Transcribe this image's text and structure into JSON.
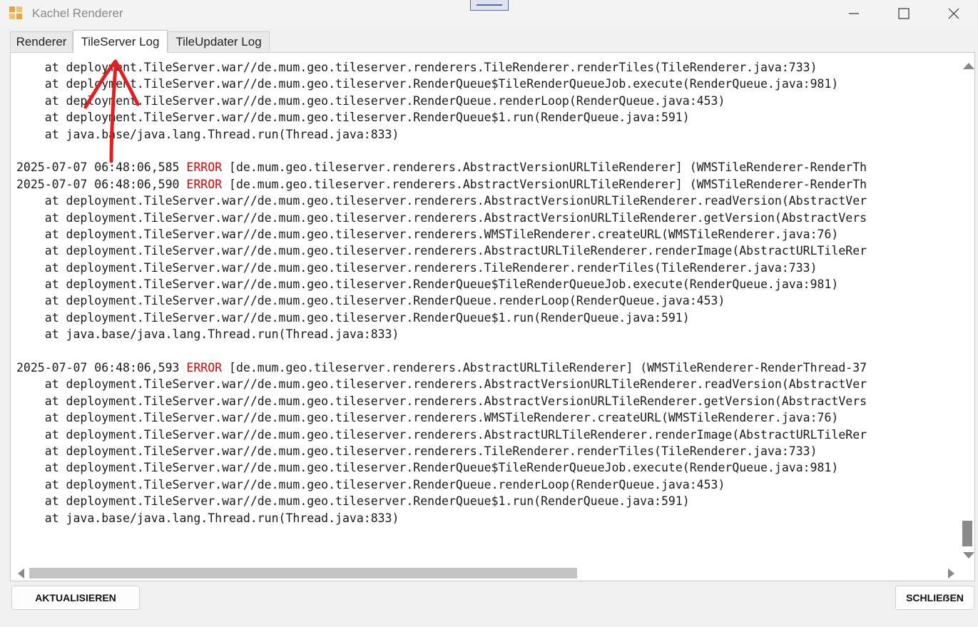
{
  "window": {
    "title": "Kachel Renderer",
    "icon": "tiles-app-icon",
    "controls": [
      "minimize-icon",
      "maximize-icon",
      "close-icon"
    ]
  },
  "tabs": [
    {
      "label": "Renderer",
      "active": false
    },
    {
      "label": "TileServer Log",
      "active": true
    },
    {
      "label": "TileUpdater Log",
      "active": false
    }
  ],
  "colors": {
    "error": "#e00000",
    "annotation": "#e02020"
  },
  "log_lines": [
    {
      "text": "    at deployment.TileServer.war//de.mum.geo.tileserver.renderers.TileRenderer.renderTiles(TileRenderer.java:733)"
    },
    {
      "text": "    at deployment.TileServer.war//de.mum.geo.tileserver.RenderQueue$TileRenderQueueJob.execute(RenderQueue.java:981)"
    },
    {
      "text": "    at deployment.TileServer.war//de.mum.geo.tileserver.RenderQueue.renderLoop(RenderQueue.java:453)"
    },
    {
      "text": "    at deployment.TileServer.war//de.mum.geo.tileserver.RenderQueue$1.run(RenderQueue.java:591)"
    },
    {
      "text": "    at java.base/java.lang.Thread.run(Thread.java:833)"
    },
    {
      "text": ""
    },
    {
      "timestamp": "2025-07-07 06:48:06,585",
      "level": "ERROR",
      "rest": "[de.mum.geo.tileserver.renderers.AbstractVersionURLTileRenderer] (WMSTileRenderer-RenderTh"
    },
    {
      "timestamp": "2025-07-07 06:48:06,590",
      "level": "ERROR",
      "rest": "[de.mum.geo.tileserver.renderers.AbstractVersionURLTileRenderer] (WMSTileRenderer-RenderTh"
    },
    {
      "text": "    at deployment.TileServer.war//de.mum.geo.tileserver.renderers.AbstractVersionURLTileRenderer.readVersion(AbstractVer"
    },
    {
      "text": "    at deployment.TileServer.war//de.mum.geo.tileserver.renderers.AbstractVersionURLTileRenderer.getVersion(AbstractVers"
    },
    {
      "text": "    at deployment.TileServer.war//de.mum.geo.tileserver.renderers.WMSTileRenderer.createURL(WMSTileRenderer.java:76)"
    },
    {
      "text": "    at deployment.TileServer.war//de.mum.geo.tileserver.renderers.AbstractURLTileRenderer.renderImage(AbstractURLTileRer"
    },
    {
      "text": "    at deployment.TileServer.war//de.mum.geo.tileserver.renderers.TileRenderer.renderTiles(TileRenderer.java:733)"
    },
    {
      "text": "    at deployment.TileServer.war//de.mum.geo.tileserver.RenderQueue$TileRenderQueueJob.execute(RenderQueue.java:981)"
    },
    {
      "text": "    at deployment.TileServer.war//de.mum.geo.tileserver.RenderQueue.renderLoop(RenderQueue.java:453)"
    },
    {
      "text": "    at deployment.TileServer.war//de.mum.geo.tileserver.RenderQueue$1.run(RenderQueue.java:591)"
    },
    {
      "text": "    at java.base/java.lang.Thread.run(Thread.java:833)"
    },
    {
      "text": ""
    },
    {
      "timestamp": "2025-07-07 06:48:06,593",
      "level": "ERROR",
      "rest": "[de.mum.geo.tileserver.renderers.AbstractURLTileRenderer] (WMSTileRenderer-RenderThread-37"
    },
    {
      "text": "    at deployment.TileServer.war//de.mum.geo.tileserver.renderers.AbstractVersionURLTileRenderer.readVersion(AbstractVer"
    },
    {
      "text": "    at deployment.TileServer.war//de.mum.geo.tileserver.renderers.AbstractVersionURLTileRenderer.getVersion(AbstractVers"
    },
    {
      "text": "    at deployment.TileServer.war//de.mum.geo.tileserver.renderers.WMSTileRenderer.createURL(WMSTileRenderer.java:76)"
    },
    {
      "text": "    at deployment.TileServer.war//de.mum.geo.tileserver.renderers.AbstractURLTileRenderer.renderImage(AbstractURLTileRer"
    },
    {
      "text": "    at deployment.TileServer.war//de.mum.geo.tileserver.renderers.TileRenderer.renderTiles(TileRenderer.java:733)"
    },
    {
      "text": "    at deployment.TileServer.war//de.mum.geo.tileserver.RenderQueue$TileRenderQueueJob.execute(RenderQueue.java:981)"
    },
    {
      "text": "    at deployment.TileServer.war//de.mum.geo.tileserver.RenderQueue.renderLoop(RenderQueue.java:453)"
    },
    {
      "text": "    at deployment.TileServer.war//de.mum.geo.tileserver.RenderQueue$1.run(RenderQueue.java:591)"
    },
    {
      "text": "    at java.base/java.lang.Thread.run(Thread.java:833)"
    }
  ],
  "scroll": {
    "vertical_position": 0.97,
    "horizontal_fraction_visible": 0.58
  },
  "buttons": {
    "refresh": "AKTUALISIEREN",
    "close": "SCHLIEẞEN"
  },
  "annotation": {
    "shape": "red hand-drawn arrow",
    "points_to": "TileServer Log tab"
  }
}
